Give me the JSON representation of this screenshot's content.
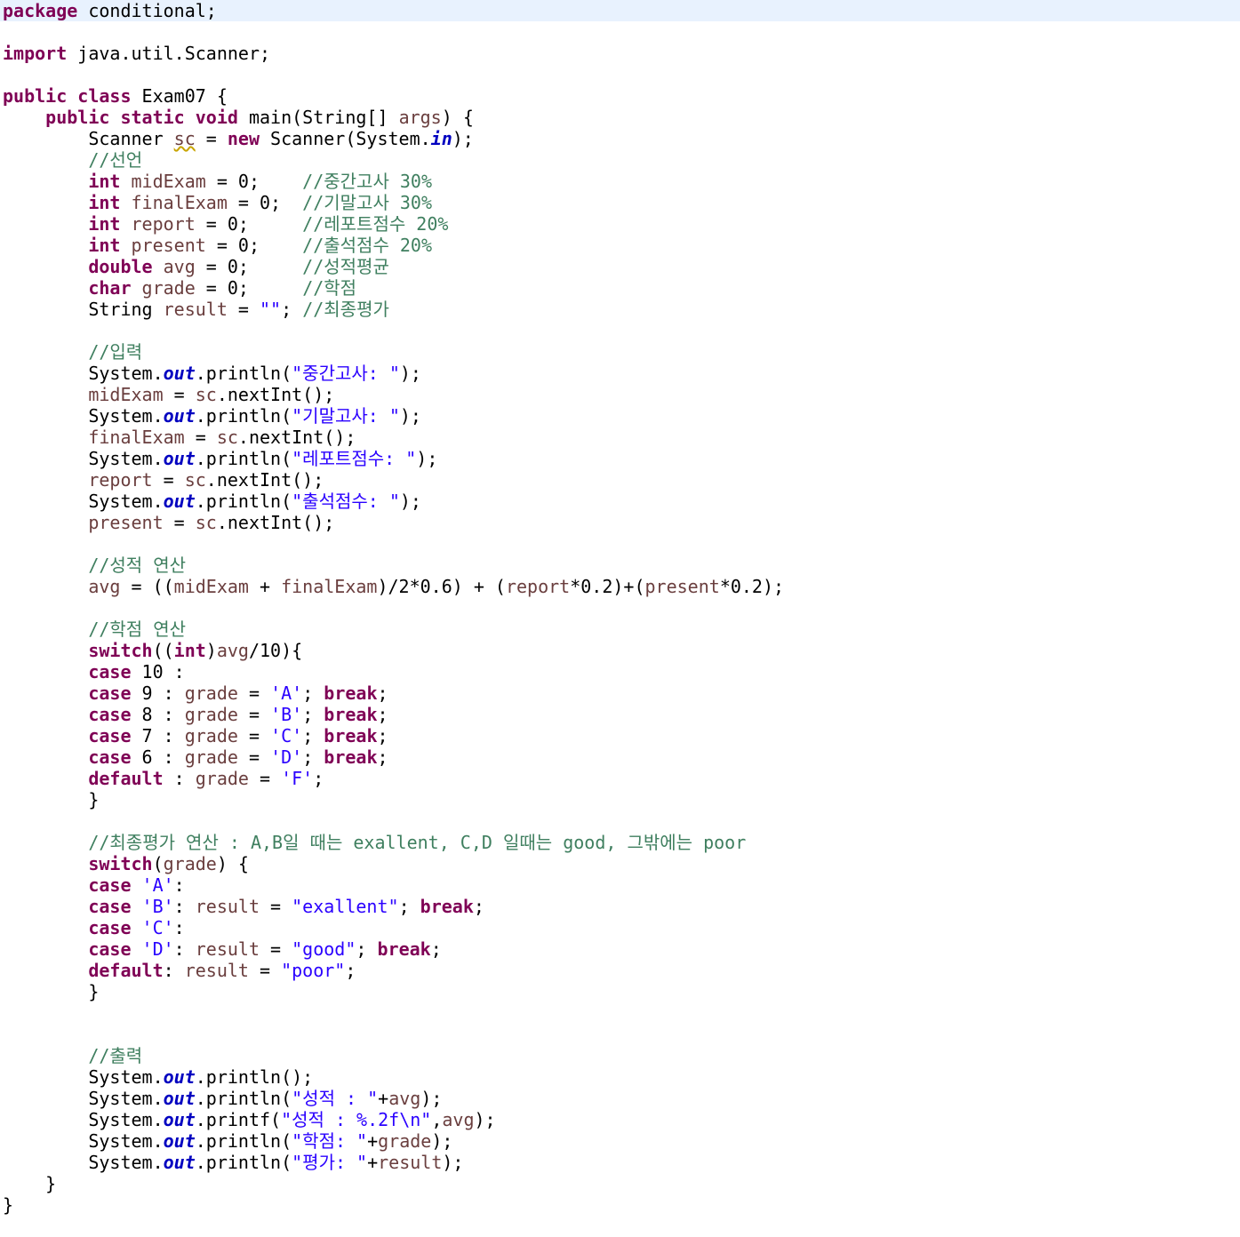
{
  "editor": {
    "highlight_line": 0,
    "colors": {
      "keyword": "#7f0055",
      "string": "#2a00ff",
      "comment": "#3f7f5f",
      "static_field": "#0000c0",
      "local_variable": "#6a3e3e",
      "current_line": "#e8f2fe"
    },
    "lines": [
      [
        {
          "t": "package",
          "c": "kw"
        },
        {
          "t": " conditional;"
        }
      ],
      [],
      [
        {
          "t": "import",
          "c": "kw"
        },
        {
          "t": " java.util.Scanner;"
        }
      ],
      [],
      [
        {
          "t": "public",
          "c": "kw"
        },
        {
          "t": " "
        },
        {
          "t": "class",
          "c": "kw"
        },
        {
          "t": " Exam07 {"
        }
      ],
      [
        {
          "t": "    "
        },
        {
          "t": "public",
          "c": "kw"
        },
        {
          "t": " "
        },
        {
          "t": "static",
          "c": "kw"
        },
        {
          "t": " "
        },
        {
          "t": "void",
          "c": "kw"
        },
        {
          "t": " main(String[] "
        },
        {
          "t": "args",
          "c": "var"
        },
        {
          "t": ") {"
        }
      ],
      [
        {
          "t": "        Scanner "
        },
        {
          "t": "sc",
          "c": "var warn"
        },
        {
          "t": " = "
        },
        {
          "t": "new",
          "c": "kw"
        },
        {
          "t": " Scanner(System."
        },
        {
          "t": "in",
          "c": "fld"
        },
        {
          "t": ");"
        }
      ],
      [
        {
          "t": "        "
        },
        {
          "t": "//선언",
          "c": "cm"
        }
      ],
      [
        {
          "t": "        "
        },
        {
          "t": "int",
          "c": "kw"
        },
        {
          "t": " "
        },
        {
          "t": "midExam",
          "c": "var"
        },
        {
          "t": " = 0;    "
        },
        {
          "t": "//중간고사 30%",
          "c": "cm"
        }
      ],
      [
        {
          "t": "        "
        },
        {
          "t": "int",
          "c": "kw"
        },
        {
          "t": " "
        },
        {
          "t": "finalExam",
          "c": "var"
        },
        {
          "t": " = 0;  "
        },
        {
          "t": "//기말고사 30%",
          "c": "cm"
        }
      ],
      [
        {
          "t": "        "
        },
        {
          "t": "int",
          "c": "kw"
        },
        {
          "t": " "
        },
        {
          "t": "report",
          "c": "var"
        },
        {
          "t": " = 0;     "
        },
        {
          "t": "//레포트점수 20%",
          "c": "cm"
        }
      ],
      [
        {
          "t": "        "
        },
        {
          "t": "int",
          "c": "kw"
        },
        {
          "t": " "
        },
        {
          "t": "present",
          "c": "var"
        },
        {
          "t": " = 0;    "
        },
        {
          "t": "//출석점수 20%",
          "c": "cm"
        }
      ],
      [
        {
          "t": "        "
        },
        {
          "t": "double",
          "c": "kw"
        },
        {
          "t": " "
        },
        {
          "t": "avg",
          "c": "var"
        },
        {
          "t": " = 0;     "
        },
        {
          "t": "//성적평균",
          "c": "cm"
        }
      ],
      [
        {
          "t": "        "
        },
        {
          "t": "char",
          "c": "kw"
        },
        {
          "t": " "
        },
        {
          "t": "grade",
          "c": "var"
        },
        {
          "t": " = 0;     "
        },
        {
          "t": "//학점",
          "c": "cm"
        }
      ],
      [
        {
          "t": "        String "
        },
        {
          "t": "result",
          "c": "var"
        },
        {
          "t": " = "
        },
        {
          "t": "\"\"",
          "c": "str"
        },
        {
          "t": "; "
        },
        {
          "t": "//최종평가",
          "c": "cm"
        }
      ],
      [],
      [
        {
          "t": "        "
        },
        {
          "t": "//입력",
          "c": "cm"
        }
      ],
      [
        {
          "t": "        System."
        },
        {
          "t": "out",
          "c": "fld"
        },
        {
          "t": ".println("
        },
        {
          "t": "\"중간고사: \"",
          "c": "str"
        },
        {
          "t": ");"
        }
      ],
      [
        {
          "t": "        "
        },
        {
          "t": "midExam",
          "c": "var"
        },
        {
          "t": " = "
        },
        {
          "t": "sc",
          "c": "var"
        },
        {
          "t": ".nextInt();"
        }
      ],
      [
        {
          "t": "        System."
        },
        {
          "t": "out",
          "c": "fld"
        },
        {
          "t": ".println("
        },
        {
          "t": "\"기말고사: \"",
          "c": "str"
        },
        {
          "t": ");"
        }
      ],
      [
        {
          "t": "        "
        },
        {
          "t": "finalExam",
          "c": "var"
        },
        {
          "t": " = "
        },
        {
          "t": "sc",
          "c": "var"
        },
        {
          "t": ".nextInt();"
        }
      ],
      [
        {
          "t": "        System."
        },
        {
          "t": "out",
          "c": "fld"
        },
        {
          "t": ".println("
        },
        {
          "t": "\"레포트점수: \"",
          "c": "str"
        },
        {
          "t": ");"
        }
      ],
      [
        {
          "t": "        "
        },
        {
          "t": "report",
          "c": "var"
        },
        {
          "t": " = "
        },
        {
          "t": "sc",
          "c": "var"
        },
        {
          "t": ".nextInt();"
        }
      ],
      [
        {
          "t": "        System."
        },
        {
          "t": "out",
          "c": "fld"
        },
        {
          "t": ".println("
        },
        {
          "t": "\"출석점수: \"",
          "c": "str"
        },
        {
          "t": ");"
        }
      ],
      [
        {
          "t": "        "
        },
        {
          "t": "present",
          "c": "var"
        },
        {
          "t": " = "
        },
        {
          "t": "sc",
          "c": "var"
        },
        {
          "t": ".nextInt();"
        }
      ],
      [],
      [
        {
          "t": "        "
        },
        {
          "t": "//성적 연산",
          "c": "cm"
        }
      ],
      [
        {
          "t": "        "
        },
        {
          "t": "avg",
          "c": "var"
        },
        {
          "t": " = (("
        },
        {
          "t": "midExam",
          "c": "var"
        },
        {
          "t": " + "
        },
        {
          "t": "finalExam",
          "c": "var"
        },
        {
          "t": ")/2*0.6) + ("
        },
        {
          "t": "report",
          "c": "var"
        },
        {
          "t": "*0.2)+("
        },
        {
          "t": "present",
          "c": "var"
        },
        {
          "t": "*0.2);"
        }
      ],
      [],
      [
        {
          "t": "        "
        },
        {
          "t": "//학점 연산",
          "c": "cm"
        }
      ],
      [
        {
          "t": "        "
        },
        {
          "t": "switch",
          "c": "kw"
        },
        {
          "t": "(("
        },
        {
          "t": "int",
          "c": "kw"
        },
        {
          "t": ")"
        },
        {
          "t": "avg",
          "c": "var"
        },
        {
          "t": "/10){"
        }
      ],
      [
        {
          "t": "        "
        },
        {
          "t": "case",
          "c": "kw"
        },
        {
          "t": " 10 :"
        }
      ],
      [
        {
          "t": "        "
        },
        {
          "t": "case",
          "c": "kw"
        },
        {
          "t": " 9 : "
        },
        {
          "t": "grade",
          "c": "var"
        },
        {
          "t": " = "
        },
        {
          "t": "'A'",
          "c": "str"
        },
        {
          "t": "; "
        },
        {
          "t": "break",
          "c": "kw"
        },
        {
          "t": ";"
        }
      ],
      [
        {
          "t": "        "
        },
        {
          "t": "case",
          "c": "kw"
        },
        {
          "t": " 8 : "
        },
        {
          "t": "grade",
          "c": "var"
        },
        {
          "t": " = "
        },
        {
          "t": "'B'",
          "c": "str"
        },
        {
          "t": "; "
        },
        {
          "t": "break",
          "c": "kw"
        },
        {
          "t": ";"
        }
      ],
      [
        {
          "t": "        "
        },
        {
          "t": "case",
          "c": "kw"
        },
        {
          "t": " 7 : "
        },
        {
          "t": "grade",
          "c": "var"
        },
        {
          "t": " = "
        },
        {
          "t": "'C'",
          "c": "str"
        },
        {
          "t": "; "
        },
        {
          "t": "break",
          "c": "kw"
        },
        {
          "t": ";"
        }
      ],
      [
        {
          "t": "        "
        },
        {
          "t": "case",
          "c": "kw"
        },
        {
          "t": " 6 : "
        },
        {
          "t": "grade",
          "c": "var"
        },
        {
          "t": " = "
        },
        {
          "t": "'D'",
          "c": "str"
        },
        {
          "t": "; "
        },
        {
          "t": "break",
          "c": "kw"
        },
        {
          "t": ";"
        }
      ],
      [
        {
          "t": "        "
        },
        {
          "t": "default",
          "c": "kw"
        },
        {
          "t": " : "
        },
        {
          "t": "grade",
          "c": "var"
        },
        {
          "t": " = "
        },
        {
          "t": "'F'",
          "c": "str"
        },
        {
          "t": ";"
        }
      ],
      [
        {
          "t": "        }"
        }
      ],
      [],
      [
        {
          "t": "        "
        },
        {
          "t": "//최종평가 연산 : A,B일 때는 exallent, C,D 일때는 good, 그밖에는 poor",
          "c": "cm"
        }
      ],
      [
        {
          "t": "        "
        },
        {
          "t": "switch",
          "c": "kw"
        },
        {
          "t": "("
        },
        {
          "t": "grade",
          "c": "var"
        },
        {
          "t": ") {"
        }
      ],
      [
        {
          "t": "        "
        },
        {
          "t": "case",
          "c": "kw"
        },
        {
          "t": " "
        },
        {
          "t": "'A'",
          "c": "str"
        },
        {
          "t": ":"
        }
      ],
      [
        {
          "t": "        "
        },
        {
          "t": "case",
          "c": "kw"
        },
        {
          "t": " "
        },
        {
          "t": "'B'",
          "c": "str"
        },
        {
          "t": ": "
        },
        {
          "t": "result",
          "c": "var"
        },
        {
          "t": " = "
        },
        {
          "t": "\"exallent\"",
          "c": "str"
        },
        {
          "t": "; "
        },
        {
          "t": "break",
          "c": "kw"
        },
        {
          "t": ";"
        }
      ],
      [
        {
          "t": "        "
        },
        {
          "t": "case",
          "c": "kw"
        },
        {
          "t": " "
        },
        {
          "t": "'C'",
          "c": "str"
        },
        {
          "t": ":"
        }
      ],
      [
        {
          "t": "        "
        },
        {
          "t": "case",
          "c": "kw"
        },
        {
          "t": " "
        },
        {
          "t": "'D'",
          "c": "str"
        },
        {
          "t": ": "
        },
        {
          "t": "result",
          "c": "var"
        },
        {
          "t": " = "
        },
        {
          "t": "\"good\"",
          "c": "str"
        },
        {
          "t": "; "
        },
        {
          "t": "break",
          "c": "kw"
        },
        {
          "t": ";"
        }
      ],
      [
        {
          "t": "        "
        },
        {
          "t": "default",
          "c": "kw"
        },
        {
          "t": ": "
        },
        {
          "t": "result",
          "c": "var"
        },
        {
          "t": " = "
        },
        {
          "t": "\"poor\"",
          "c": "str"
        },
        {
          "t": ";"
        }
      ],
      [
        {
          "t": "        }"
        }
      ],
      [],
      [],
      [
        {
          "t": "        "
        },
        {
          "t": "//출력",
          "c": "cm"
        }
      ],
      [
        {
          "t": "        System."
        },
        {
          "t": "out",
          "c": "fld"
        },
        {
          "t": ".println();"
        }
      ],
      [
        {
          "t": "        System."
        },
        {
          "t": "out",
          "c": "fld"
        },
        {
          "t": ".println("
        },
        {
          "t": "\"성적 : \"",
          "c": "str"
        },
        {
          "t": "+"
        },
        {
          "t": "avg",
          "c": "var"
        },
        {
          "t": ");"
        }
      ],
      [
        {
          "t": "        System."
        },
        {
          "t": "out",
          "c": "fld"
        },
        {
          "t": ".printf("
        },
        {
          "t": "\"성적 : %.2f\\n\"",
          "c": "str"
        },
        {
          "t": ","
        },
        {
          "t": "avg",
          "c": "var"
        },
        {
          "t": ");"
        }
      ],
      [
        {
          "t": "        System."
        },
        {
          "t": "out",
          "c": "fld"
        },
        {
          "t": ".println("
        },
        {
          "t": "\"학점: \"",
          "c": "str"
        },
        {
          "t": "+"
        },
        {
          "t": "grade",
          "c": "var"
        },
        {
          "t": ");"
        }
      ],
      [
        {
          "t": "        System."
        },
        {
          "t": "out",
          "c": "fld"
        },
        {
          "t": ".println("
        },
        {
          "t": "\"평가: \"",
          "c": "str"
        },
        {
          "t": "+"
        },
        {
          "t": "result",
          "c": "var"
        },
        {
          "t": ");"
        }
      ],
      [
        {
          "t": "    }"
        }
      ],
      [
        {
          "t": "}"
        }
      ]
    ]
  }
}
